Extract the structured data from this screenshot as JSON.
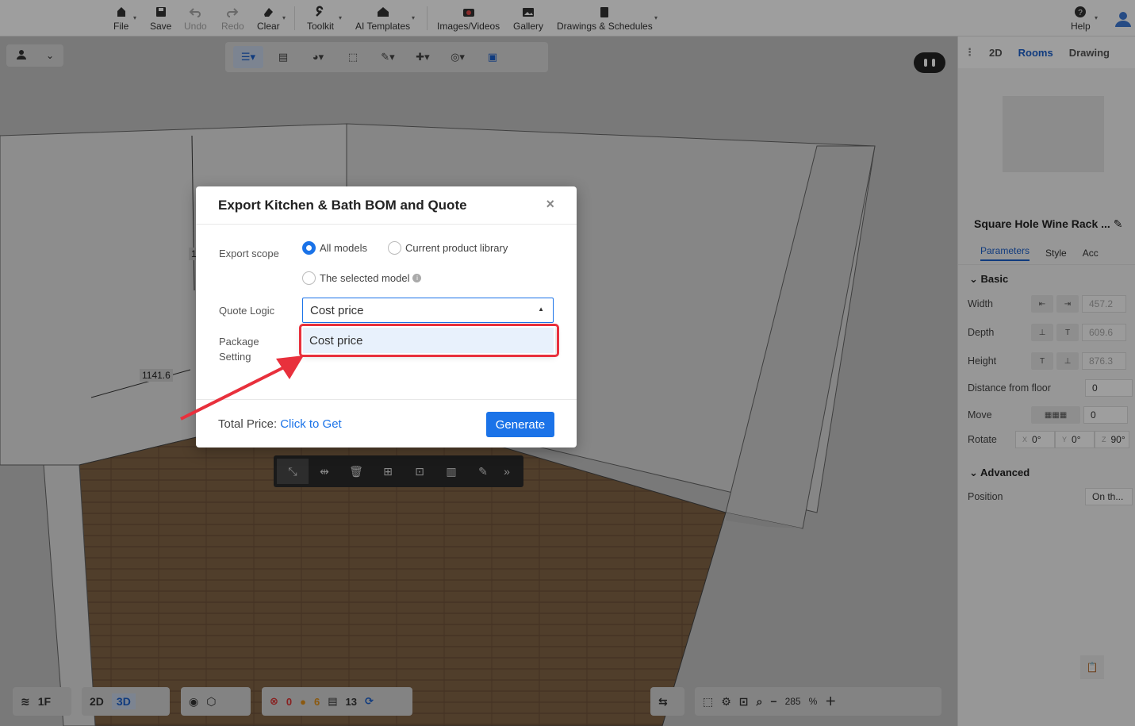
{
  "toolbar": {
    "file": "File",
    "save": "Save",
    "undo": "Undo",
    "redo": "Redo",
    "clear": "Clear",
    "toolkit": "Toolkit",
    "ai_templates": "AI Templates",
    "images_videos": "Images/Videos",
    "gallery": "Gallery",
    "drawings": "Drawings & Schedules",
    "help": "Help"
  },
  "viewport": {
    "dim_1": "1141.6",
    "dim_partial": "1",
    "float_more": "»"
  },
  "bottom": {
    "floor": "1F",
    "view2d": "2D",
    "view3d": "3D",
    "err_count": "0",
    "warn_count": "6",
    "items_count": "13",
    "zoom_value": "285",
    "zoom_unit": "%"
  },
  "right_panel": {
    "tabs": [
      "2D",
      "Rooms",
      "Drawing"
    ],
    "title": "Square Hole Wine Rack ...",
    "subtabs": [
      "Parameters",
      "Style",
      "Acc"
    ],
    "section_basic": "Basic",
    "width_label": "Width",
    "width_value": "457.2",
    "depth_label": "Depth",
    "depth_value": "609.6",
    "height_label": "Height",
    "height_value": "876.3",
    "floor_label": "Distance from floor",
    "floor_value": "0",
    "move_label": "Move",
    "move_value": "0",
    "rotate_label": "Rotate",
    "rot_x": "0°",
    "rot_y": "0°",
    "rot_z": "90°",
    "rot_x_axis": "X",
    "rot_y_axis": "Y",
    "rot_z_axis": "Z",
    "section_advanced": "Advanced",
    "position_label": "Position",
    "position_value": "On th..."
  },
  "modal": {
    "title": "Export Kitchen & Bath BOM and Quote",
    "close": "×",
    "scope_label": "Export scope",
    "scope_all": "All models",
    "scope_library": "Current product library",
    "scope_selected": "The selected model",
    "quote_label": "Quote Logic",
    "quote_value": "Cost price",
    "dropdown_option": "Cost price",
    "package_label_1": "Package",
    "package_label_2": "Setting",
    "total_label": "Total Price:",
    "total_link": "Click to Get",
    "generate": "Generate"
  },
  "colors": {
    "accent": "#1b73e8",
    "highlight": "#e8303c"
  }
}
